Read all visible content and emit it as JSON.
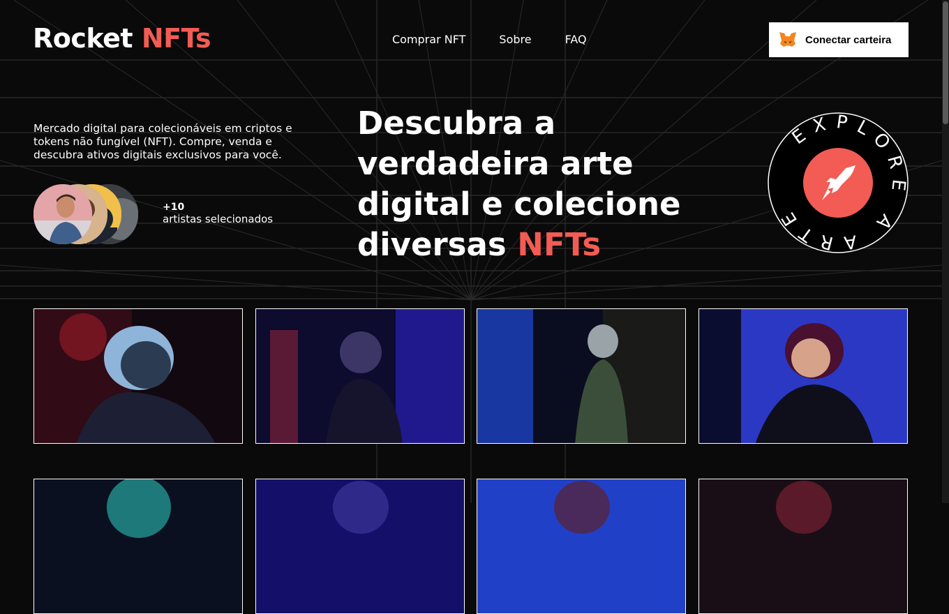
{
  "logo": {
    "text": "Rocket ",
    "accent": "NFTs"
  },
  "nav": {
    "items": [
      {
        "label": "Comprar NFT"
      },
      {
        "label": "Sobre"
      },
      {
        "label": "FAQ"
      }
    ]
  },
  "connect_button": {
    "label": "Conectar carteira",
    "icon": "metamask-fox-icon"
  },
  "intro": {
    "text": "Mercado digital para colecionáveis em criptos e tokens não fungível (NFT). Compre, venda e descubra ativos digitais exclusivos para você."
  },
  "artists": {
    "count": "+10",
    "label": "artistas selecionados"
  },
  "headline": {
    "text": "Descubra a verdadeira arte digital e colecione diversas ",
    "accent": "NFTs"
  },
  "badge": {
    "text": "EXPLORE A ARTE",
    "icon": "rocket-icon"
  },
  "colors": {
    "accent": "#f25c54",
    "background": "#0a0a0a"
  }
}
